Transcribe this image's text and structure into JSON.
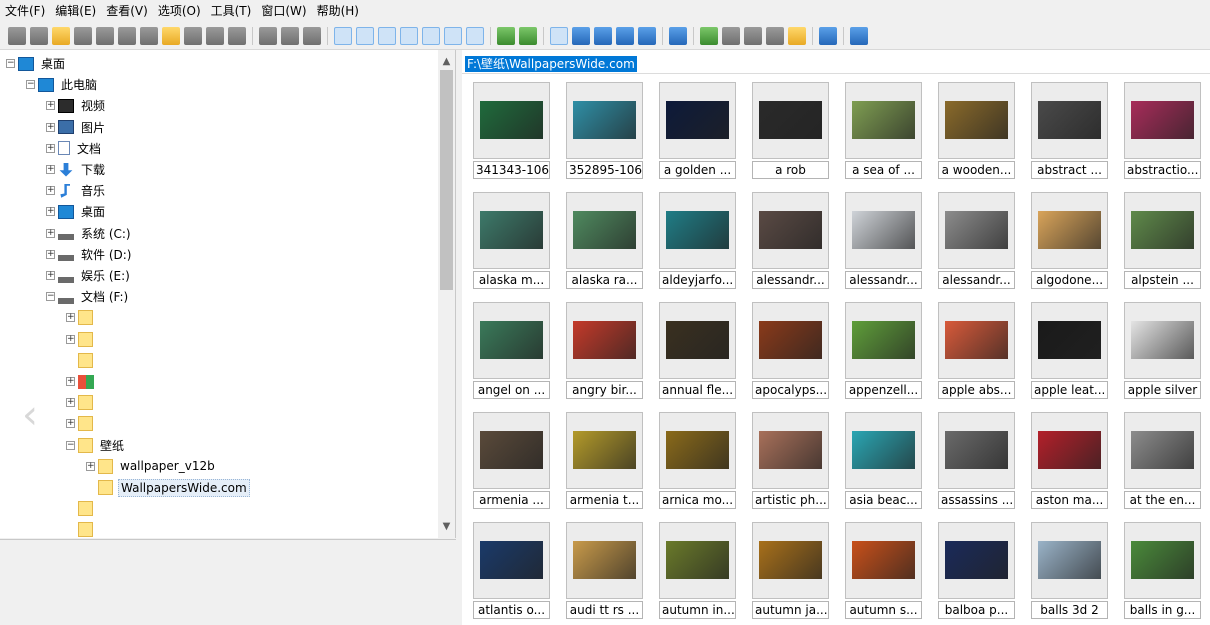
{
  "menu": [
    "文件(F)",
    "编辑(E)",
    "查看(V)",
    "选项(O)",
    "工具(T)",
    "窗口(W)",
    "帮助(H)"
  ],
  "toolbar": [
    {
      "icon": "eye-icon",
      "color": "g"
    },
    {
      "icon": "eye-off-icon",
      "color": "g"
    },
    {
      "icon": "open-folder-icon",
      "color": "y"
    },
    {
      "icon": "copy-window-icon",
      "color": "g"
    },
    {
      "icon": "print-icon",
      "color": "g"
    },
    {
      "icon": "info-icon",
      "color": "g"
    },
    {
      "icon": "camera-icon",
      "color": "g"
    },
    {
      "icon": "new-folder-icon",
      "color": "y"
    },
    {
      "icon": "rename-icon",
      "color": "g"
    },
    {
      "icon": "delete-icon",
      "color": "g"
    },
    {
      "icon": "properties-icon",
      "color": "g"
    },
    {
      "sep": true
    },
    {
      "icon": "cut-icon",
      "color": "g"
    },
    {
      "icon": "copy-icon",
      "color": "g"
    },
    {
      "icon": "paste-icon",
      "color": "g"
    },
    {
      "sep": true
    },
    {
      "icon": "fullscreen-icon",
      "color": "b",
      "pressed": true
    },
    {
      "icon": "folder-tree-icon",
      "color": "y",
      "pressed": true
    },
    {
      "icon": "preview-icon",
      "color": "b",
      "pressed": true
    },
    {
      "icon": "thumbnails-icon",
      "color": "y",
      "pressed": true
    },
    {
      "icon": "grid-view-icon",
      "color": "g",
      "pressed": true
    },
    {
      "icon": "window-icon",
      "color": "b",
      "pressed": true
    },
    {
      "icon": "image-icon",
      "color": "gr",
      "pressed": true
    },
    {
      "sep": true
    },
    {
      "icon": "slideshow-icon",
      "color": "gr"
    },
    {
      "icon": "refresh-icon",
      "color": "gr"
    },
    {
      "sep": true
    },
    {
      "icon": "view-large-icon",
      "color": "b",
      "pressed": true
    },
    {
      "icon": "view-medium-icon",
      "color": "b"
    },
    {
      "icon": "view-small-icon",
      "color": "b"
    },
    {
      "icon": "view-list-icon",
      "color": "b"
    },
    {
      "icon": "view-details-icon",
      "color": "b"
    },
    {
      "sep": true
    },
    {
      "icon": "wrench-icon",
      "color": "b"
    },
    {
      "sep": true
    },
    {
      "icon": "batch-convert-icon",
      "color": "gr"
    },
    {
      "icon": "find-icon",
      "color": "g"
    },
    {
      "icon": "monitor-icon",
      "color": "g"
    },
    {
      "icon": "filmstrip-icon",
      "color": "g"
    },
    {
      "icon": "edit-icon",
      "color": "y"
    },
    {
      "sep": true
    },
    {
      "icon": "settings-icon",
      "color": "b"
    },
    {
      "sep": true
    },
    {
      "icon": "help-icon",
      "color": "b"
    }
  ],
  "tree": [
    {
      "label": "桌面",
      "icon": "screen",
      "exp": "−"
    },
    {
      "label": "此电脑",
      "icon": "screen",
      "exp": "−"
    },
    {
      "label": "视频",
      "icon": "video",
      "exp": "+"
    },
    {
      "label": "图片",
      "icon": "pic",
      "exp": "+"
    },
    {
      "label": "文档",
      "icon": "doc",
      "exp": "+"
    },
    {
      "label": "下载",
      "icon": "arrow",
      "exp": "+"
    },
    {
      "label": "音乐",
      "icon": "note",
      "exp": "+"
    },
    {
      "label": "桌面",
      "icon": "screen",
      "exp": "+"
    },
    {
      "label": "系统 (C:)",
      "icon": "drive",
      "exp": "+"
    },
    {
      "label": "软件 (D:)",
      "icon": "drive",
      "exp": "+"
    },
    {
      "label": "娱乐 (E:)",
      "icon": "drive",
      "exp": "+"
    },
    {
      "label": "文档 (F:)",
      "icon": "drive",
      "exp": "−"
    },
    {
      "label": "",
      "icon": "folder",
      "exp": "+"
    },
    {
      "label": "",
      "icon": "folder",
      "exp": "+"
    },
    {
      "label": "",
      "icon": "folder",
      "exp": ""
    },
    {
      "label": "",
      "icon": "multi",
      "exp": "+"
    },
    {
      "label": "",
      "icon": "folder",
      "exp": "+"
    },
    {
      "label": "",
      "icon": "folder",
      "exp": "+"
    },
    {
      "label": "壁纸",
      "icon": "folder",
      "exp": "−"
    },
    {
      "label": "wallpaper_v12b",
      "icon": "folder",
      "exp": "+"
    },
    {
      "label": "WallpapersWide.com",
      "icon": "folder",
      "exp": "",
      "selected": true
    },
    {
      "label": "",
      "icon": "folder",
      "exp": ""
    },
    {
      "label": "",
      "icon": "folder",
      "exp": ""
    }
  ],
  "path": "F:\\壁纸\\WallpapersWide.com",
  "thumbnails": [
    {
      "caption": "341343-106",
      "color": "#1f6b3c"
    },
    {
      "caption": "352895-106",
      "color": "#2f8fa6"
    },
    {
      "caption": "a golden ...",
      "color": "#0d1a3a"
    },
    {
      "caption": "a rob",
      "color": "#2a2a2a"
    },
    {
      "caption": "a sea of ...",
      "color": "#7f9e52"
    },
    {
      "caption": "a wooden...",
      "color": "#8a6a2a"
    },
    {
      "caption": "abstract ...",
      "color": "#4a4a4a"
    },
    {
      "caption": "abstractio...",
      "color": "#a82c5a"
    },
    {
      "caption": "alaska m...",
      "color": "#3d7a6a"
    },
    {
      "caption": "alaska ra...",
      "color": "#4f8a5f"
    },
    {
      "caption": "aldeyjarfo...",
      "color": "#1f7d86"
    },
    {
      "caption": "alessandr...",
      "color": "#5a4a44"
    },
    {
      "caption": "alessandr...",
      "color": "#cfd3d8"
    },
    {
      "caption": "alessandr...",
      "color": "#8c8c8c"
    },
    {
      "caption": "algodone...",
      "color": "#d9a45a"
    },
    {
      "caption": "alpstein ...",
      "color": "#5f8a4a"
    },
    {
      "caption": "angel on ...",
      "color": "#3a7a5a"
    },
    {
      "caption": "angry bir...",
      "color": "#c43a2a"
    },
    {
      "caption": "annual fle...",
      "color": "#3a3020"
    },
    {
      "caption": "apocalyps...",
      "color": "#8a3a1a"
    },
    {
      "caption": "appenzell...",
      "color": "#5f9e3a"
    },
    {
      "caption": "apple abs...",
      "color": "#d85a3a"
    },
    {
      "caption": "apple leat...",
      "color": "#1a1a1a"
    },
    {
      "caption": "apple silver",
      "color": "#e4e4e4"
    },
    {
      "caption": "armenia ...",
      "color": "#5a4a3a"
    },
    {
      "caption": "armenia t...",
      "color": "#b39a2a"
    },
    {
      "caption": "arnica mo...",
      "color": "#8a6a1a"
    },
    {
      "caption": "artistic ph...",
      "color": "#a8705a"
    },
    {
      "caption": "asia beac...",
      "color": "#2aa6b3"
    },
    {
      "caption": "assassins ...",
      "color": "#6a6a6a"
    },
    {
      "caption": "aston ma...",
      "color": "#b3202a"
    },
    {
      "caption": "at the en...",
      "color": "#8c8c8c"
    },
    {
      "caption": "atlantis o...",
      "color": "#1a3a6a"
    },
    {
      "caption": "audi tt rs ...",
      "color": "#c89a4a"
    },
    {
      "caption": "autumn in...",
      "color": "#6a7a2a"
    },
    {
      "caption": "autumn ja...",
      "color": "#a8701a"
    },
    {
      "caption": "autumn s...",
      "color": "#c8501a"
    },
    {
      "caption": "balboa p...",
      "color": "#1a2a5a"
    },
    {
      "caption": "balls 3d 2",
      "color": "#9ab3c8"
    },
    {
      "caption": "balls in g...",
      "color": "#4a8a3a"
    }
  ]
}
